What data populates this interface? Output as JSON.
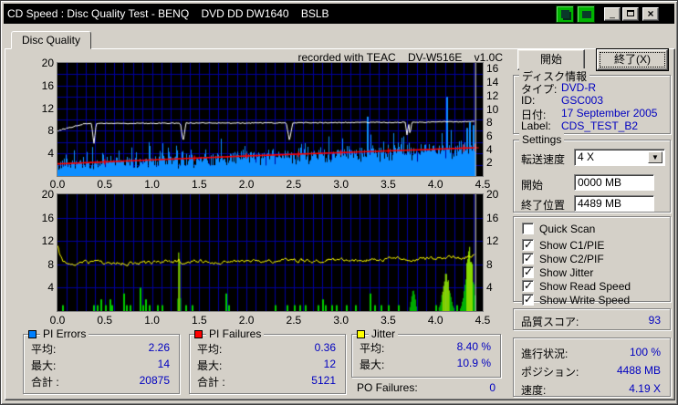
{
  "colors": {
    "window_bg": "#D4D0C8",
    "titlebar": "#000000",
    "chart_bg": "#000000",
    "grid": "#0000A0",
    "pi_errors_bar": "#0D8EFF",
    "pi_failures_bar": "#00CC00",
    "pi_failures_bright": "#9FFF00",
    "write_speed_line": "#FFFFFF",
    "read_speed_line": "#FF0000",
    "jitter_line": "#FFFF00",
    "cursor": "#DDDDDD",
    "value_text": "#0000C0"
  },
  "window": {
    "title": "CD Speed : Disc Quality Test - BENQ    DVD DD DW1640    BSLB",
    "buttons": {
      "minimize": "_",
      "maximize": "",
      "close": "×"
    }
  },
  "tab": {
    "label": "Disc Quality"
  },
  "recorded_note": "recorded with TEAC    DV-W516E    v1.0C",
  "actions": {
    "start": "開始",
    "exit": "終了(X)"
  },
  "disc_info": {
    "title": "ディスク情報",
    "rows": [
      {
        "label": "タイプ:",
        "value": "DVD-R"
      },
      {
        "label": "ID:",
        "value": "GSC003"
      },
      {
        "label": "日付:",
        "value": "17 September 2005"
      },
      {
        "label": "Label:",
        "value": "CDS_TEST_B2"
      }
    ]
  },
  "settings": {
    "title": "Settings",
    "speed_label": "転送速度",
    "speed_value": "4 X",
    "start_label": "開始",
    "start_value": "0000 MB",
    "end_label": "終了位置",
    "end_value": "4489 MB"
  },
  "options": [
    {
      "label": "Quick Scan",
      "checked": false
    },
    {
      "label": "Show C1/PIE",
      "checked": true
    },
    {
      "label": "Show C2/PIF",
      "checked": true
    },
    {
      "label": "Show Jitter",
      "checked": true
    },
    {
      "label": "Show Read Speed",
      "checked": true
    },
    {
      "label": "Show Write Speed",
      "checked": true
    }
  ],
  "quality_score": {
    "label": "品質スコア:",
    "value": "93"
  },
  "progress": {
    "rows": [
      {
        "label": "進行状況:",
        "value": "100 %"
      },
      {
        "label": "ポジション:",
        "value": "4488 MB"
      },
      {
        "label": "速度:",
        "value": "4.19 X"
      }
    ]
  },
  "stats": {
    "pi_errors": {
      "title": "PI Errors",
      "swatch": "#0080FF",
      "rows": [
        {
          "label": "平均:",
          "value": "2.26"
        },
        {
          "label": "最大:",
          "value": "14"
        },
        {
          "label": "合計 :",
          "value": "20875"
        }
      ]
    },
    "pi_failures": {
      "title": "PI Failures",
      "swatch": "#FF0000",
      "rows": [
        {
          "label": "平均:",
          "value": "0.36"
        },
        {
          "label": "最大:",
          "value": "12"
        },
        {
          "label": "合計 :",
          "value": "5121"
        }
      ]
    },
    "jitter": {
      "title": "Jitter",
      "swatch": "#FFFF00",
      "rows": [
        {
          "label": "平均:",
          "value": "8.40 %"
        },
        {
          "label": "最大:",
          "value": "10.9 %"
        }
      ]
    },
    "po_failures": {
      "label": "PO Failures:",
      "value": "0"
    }
  },
  "chart_data": [
    {
      "type": "bar",
      "name": "top-quality-chart",
      "x_range_gb": [
        0,
        4.5
      ],
      "x_ticks": [
        "0.0",
        "0.5",
        "1.0",
        "1.5",
        "2.0",
        "2.5",
        "3.0",
        "3.5",
        "4.0",
        "4.5"
      ],
      "left_axis": {
        "range": [
          0,
          20
        ],
        "ticks": [
          4,
          8,
          12,
          16,
          20
        ]
      },
      "right_axis": {
        "range": [
          0,
          16
        ],
        "ticks": [
          2,
          4,
          6,
          8,
          10,
          12,
          14,
          16
        ]
      },
      "grid": true,
      "cursor_gb": 4.42,
      "series": [
        {
          "name": "PI Errors",
          "type": "bar",
          "average": 2.26,
          "max": 14,
          "total": 20875,
          "base_start": 1.6,
          "base_slope": 0.75,
          "noise": 1.5,
          "spike_chance": 0.15,
          "spike_extra": 3.0,
          "spikes": [
            [
              3.28,
              10.5
            ],
            [
              4.12,
              14
            ],
            [
              4.33,
              8.5
            ],
            [
              4.36,
              9.5
            ],
            [
              4.4,
              9.0
            ]
          ]
        },
        {
          "name": "Write Speed",
          "type": "line",
          "points": [
            [
              0,
              8.0
            ],
            [
              0.28,
              9.25
            ],
            [
              0.36,
              9.3
            ],
            [
              0.385,
              5.6
            ],
            [
              0.41,
              9.3
            ],
            [
              1.3,
              9.35
            ],
            [
              1.33,
              6.1
            ],
            [
              1.36,
              9.35
            ],
            [
              2.42,
              9.4
            ],
            [
              2.455,
              6.3
            ],
            [
              2.49,
              9.4
            ],
            [
              3.68,
              9.5
            ],
            [
              3.7,
              7.0
            ],
            [
              3.715,
              9.5
            ],
            [
              3.73,
              7.3
            ],
            [
              3.75,
              9.5
            ],
            [
              4.15,
              9.6
            ],
            [
              4.42,
              9.65
            ]
          ]
        },
        {
          "name": "Read Speed",
          "type": "line",
          "points": [
            [
              0,
              2.15
            ],
            [
              0.5,
              2.5
            ],
            [
              1.0,
              2.85
            ],
            [
              1.5,
              3.2
            ],
            [
              2.0,
              3.55
            ],
            [
              2.5,
              3.85
            ],
            [
              3.0,
              4.15
            ],
            [
              3.5,
              4.45
            ],
            [
              4.0,
              4.75
            ],
            [
              4.42,
              5.0
            ]
          ],
          "tick_marks": [
            0.5,
            1.45,
            2.0,
            2.55,
            3.0,
            3.5
          ],
          "cross_marks": [
            4.3,
            4.42
          ]
        }
      ]
    },
    {
      "type": "bar",
      "name": "bottom-quality-chart",
      "x_range_gb": [
        0,
        4.5
      ],
      "x_ticks": [
        "0.0",
        "0.5",
        "1.0",
        "1.5",
        "2.0",
        "2.5",
        "3.0",
        "3.5",
        "4.0",
        "4.5"
      ],
      "left_axis": {
        "range": [
          0,
          20
        ],
        "ticks": [
          4,
          8,
          12,
          16,
          20
        ]
      },
      "right_axis": {
        "range": [
          0,
          20
        ],
        "ticks": [
          4,
          8,
          12,
          16,
          20
        ]
      },
      "grid": true,
      "cursor_gb": 4.42,
      "series": [
        {
          "name": "PI Failures",
          "type": "bar",
          "average": 0.36,
          "max": 12,
          "total": 5121,
          "spikes": [
            [
              0.05,
              1
            ],
            [
              0.38,
              1
            ],
            [
              0.42,
              1
            ],
            [
              0.45,
              2
            ],
            [
              0.5,
              1
            ],
            [
              0.55,
              2
            ],
            [
              0.57,
              1
            ],
            [
              0.7,
              3
            ],
            [
              0.72,
              1
            ],
            [
              0.76,
              1
            ],
            [
              0.87,
              4
            ],
            [
              0.9,
              1
            ],
            [
              0.93,
              2
            ],
            [
              0.97,
              1
            ],
            [
              1.05,
              1
            ],
            [
              1.1,
              1
            ],
            [
              1.35,
              1
            ],
            [
              1.42,
              1
            ],
            [
              1.78,
              3
            ],
            [
              1.81,
              1
            ],
            [
              2.3,
              1
            ],
            [
              2.42,
              1
            ],
            [
              2.5,
              1
            ],
            [
              2.56,
              1
            ],
            [
              2.62,
              1
            ],
            [
              2.75,
              1
            ],
            [
              2.8,
              2
            ],
            [
              2.83,
              1
            ],
            [
              2.9,
              1
            ],
            [
              2.95,
              1
            ],
            [
              3.05,
              1
            ],
            [
              3.15,
              1
            ],
            [
              3.3,
              3
            ],
            [
              3.35,
              1
            ],
            [
              3.42,
              1
            ],
            [
              3.5,
              1
            ],
            [
              3.6,
              1
            ],
            [
              4.0,
              1
            ],
            [
              4.22,
              1
            ]
          ],
          "clusters": [
            {
              "center": 1.283,
              "sigma": 0.008,
              "peak": 12
            },
            {
              "center": 3.76,
              "sigma": 0.018,
              "peak": 4
            },
            {
              "center": 4.11,
              "sigma": 0.035,
              "peak": 6
            },
            {
              "center": 4.355,
              "sigma": 0.038,
              "peak": 10
            }
          ]
        },
        {
          "name": "Jitter",
          "type": "line",
          "average_pct": 8.4,
          "max_pct": 10.9,
          "base": [
            [
              0,
              11.0
            ],
            [
              0.03,
              9.2
            ],
            [
              0.06,
              8.3
            ],
            [
              0.5,
              8.25
            ],
            [
              1.0,
              8.2
            ],
            [
              1.27,
              8.5
            ],
            [
              1.283,
              9.1
            ],
            [
              1.3,
              8.4
            ],
            [
              2.0,
              8.5
            ],
            [
              3.0,
              8.7
            ],
            [
              4.0,
              9.0
            ],
            [
              4.3,
              9.2
            ],
            [
              4.38,
              9.6
            ],
            [
              4.42,
              9.9
            ]
          ],
          "noise": 0.28
        }
      ]
    }
  ]
}
